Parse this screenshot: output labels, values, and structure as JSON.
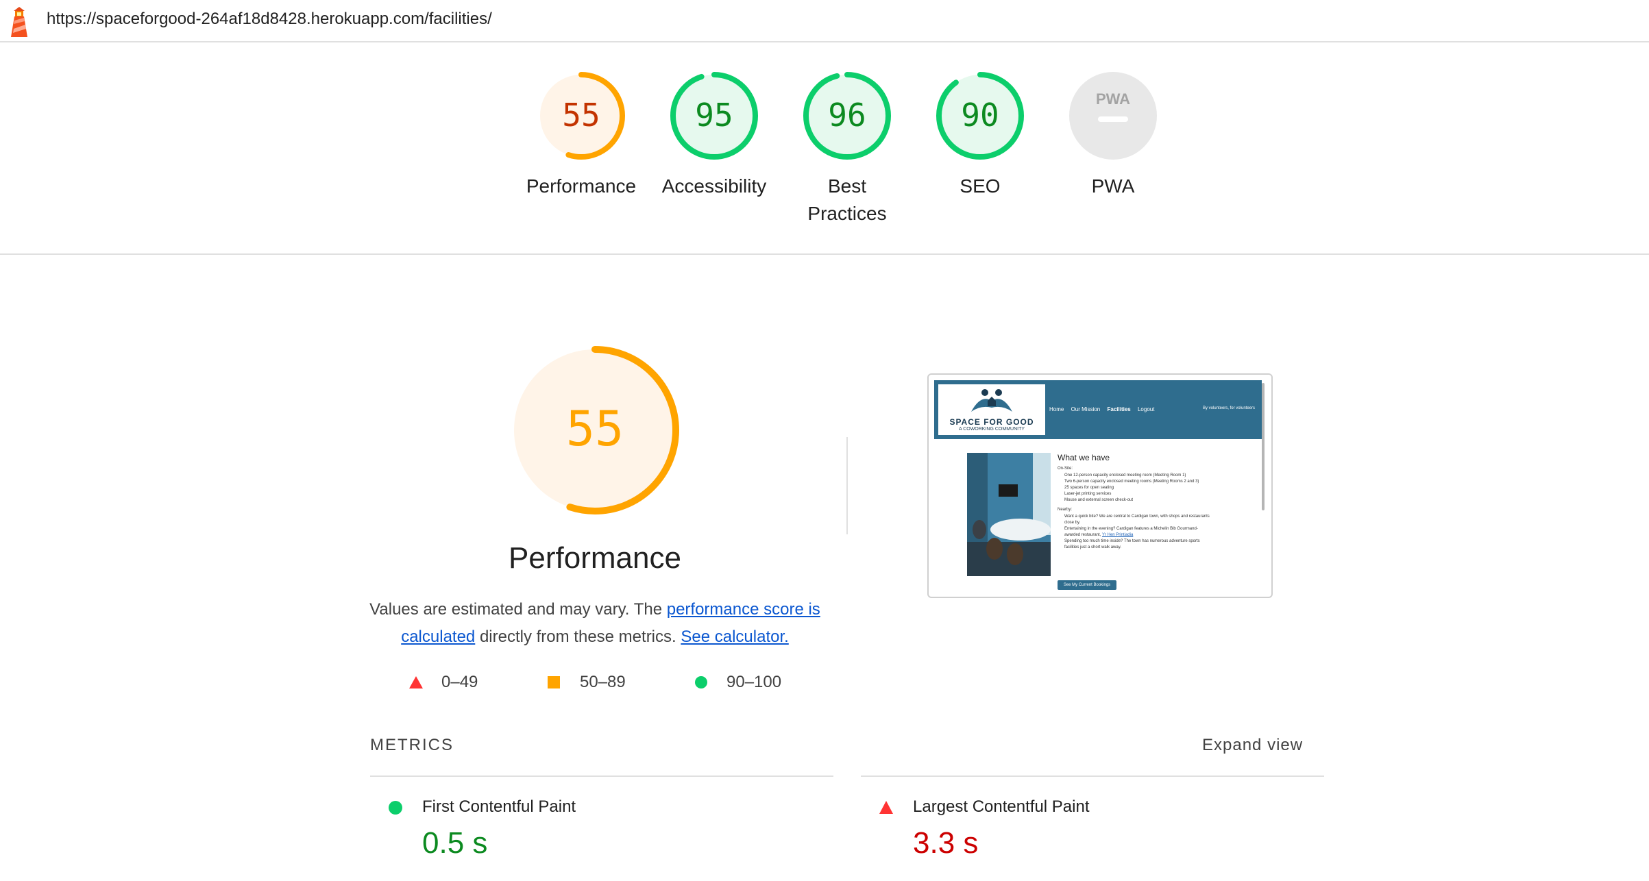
{
  "url": "https://spaceforgood-264af18d8428.herokuapp.com/facilities/",
  "colors": {
    "pass": "#0c8a20",
    "average": "#c33300",
    "average_ring": "#ffa400",
    "fail": "#cc0000",
    "fail_icon": "#ff3333",
    "pass_icon": "#0cce6b",
    "link": "#0b57d0"
  },
  "gauges": [
    {
      "score": "55",
      "label": "Performance",
      "level": "average",
      "fraction": 0.55
    },
    {
      "score": "95",
      "label": "Accessibility",
      "level": "pass",
      "fraction": 0.95
    },
    {
      "score": "96",
      "label_line1": "Best",
      "label_line2": "Practices",
      "level": "pass",
      "fraction": 0.96
    },
    {
      "score": "90",
      "label": "SEO",
      "level": "pass",
      "fraction": 0.9
    },
    {
      "label": "PWA",
      "badge": "PWA",
      "level": "na"
    }
  ],
  "performance": {
    "score": "55",
    "fraction": 0.55,
    "title": "Performance",
    "desc_prefix": "Values are estimated and may vary. The ",
    "desc_link1": "performance score is calculated",
    "desc_middle": " directly from these metrics. ",
    "desc_link2": "See calculator."
  },
  "legend": [
    {
      "icon": "fail-triangle-icon",
      "range": "0–49"
    },
    {
      "icon": "average-square-icon",
      "range": "50–89"
    },
    {
      "icon": "pass-circle-icon",
      "range": "90–100"
    }
  ],
  "thumbnail": {
    "logo_title": "SPACE FOR GOOD",
    "logo_sub": "A COWORKING COMMUNITY",
    "nav": [
      "Home",
      "Our Mission",
      "Facilities",
      "Logout"
    ],
    "tagline": "By volunteers, for volunteers",
    "heading": "What we have",
    "onsite_label": "On-Site:",
    "onsite_items": [
      "One 12-person capacity enclosed meeting room (Meeting Room 1)",
      "Two 6-person capacity enclosed meeting rooms (Meeting Rooms 2 and 3)",
      "25 spaces for open seating",
      "Laser-jet printing services",
      "Mouse and external screen check-out"
    ],
    "nearby_label": "Nearby:",
    "nearby_items": [
      "Want a quick bite? We are central to Cardigan town, with shops and restaurants",
      "close by.",
      "Entertaining in the evening? Cardigan features a Michelin Bib Gourmand-",
      "awarded restaurant, ",
      "Spending too much time inside? The town has numerous adventure sports",
      "facilities just a short walk away."
    ],
    "nearby_link": "Yr Hen Printiadia",
    "button": "See My Current Bookings"
  },
  "metrics": {
    "title": "METRICS",
    "expand": "Expand view",
    "items": [
      {
        "icon": "pass-circle-icon",
        "label": "First Contentful Paint",
        "value": "0.5 s",
        "level": "pass"
      },
      {
        "icon": "fail-triangle-icon",
        "label": "Largest Contentful Paint",
        "value": "3.3 s",
        "level": "fail"
      }
    ]
  }
}
